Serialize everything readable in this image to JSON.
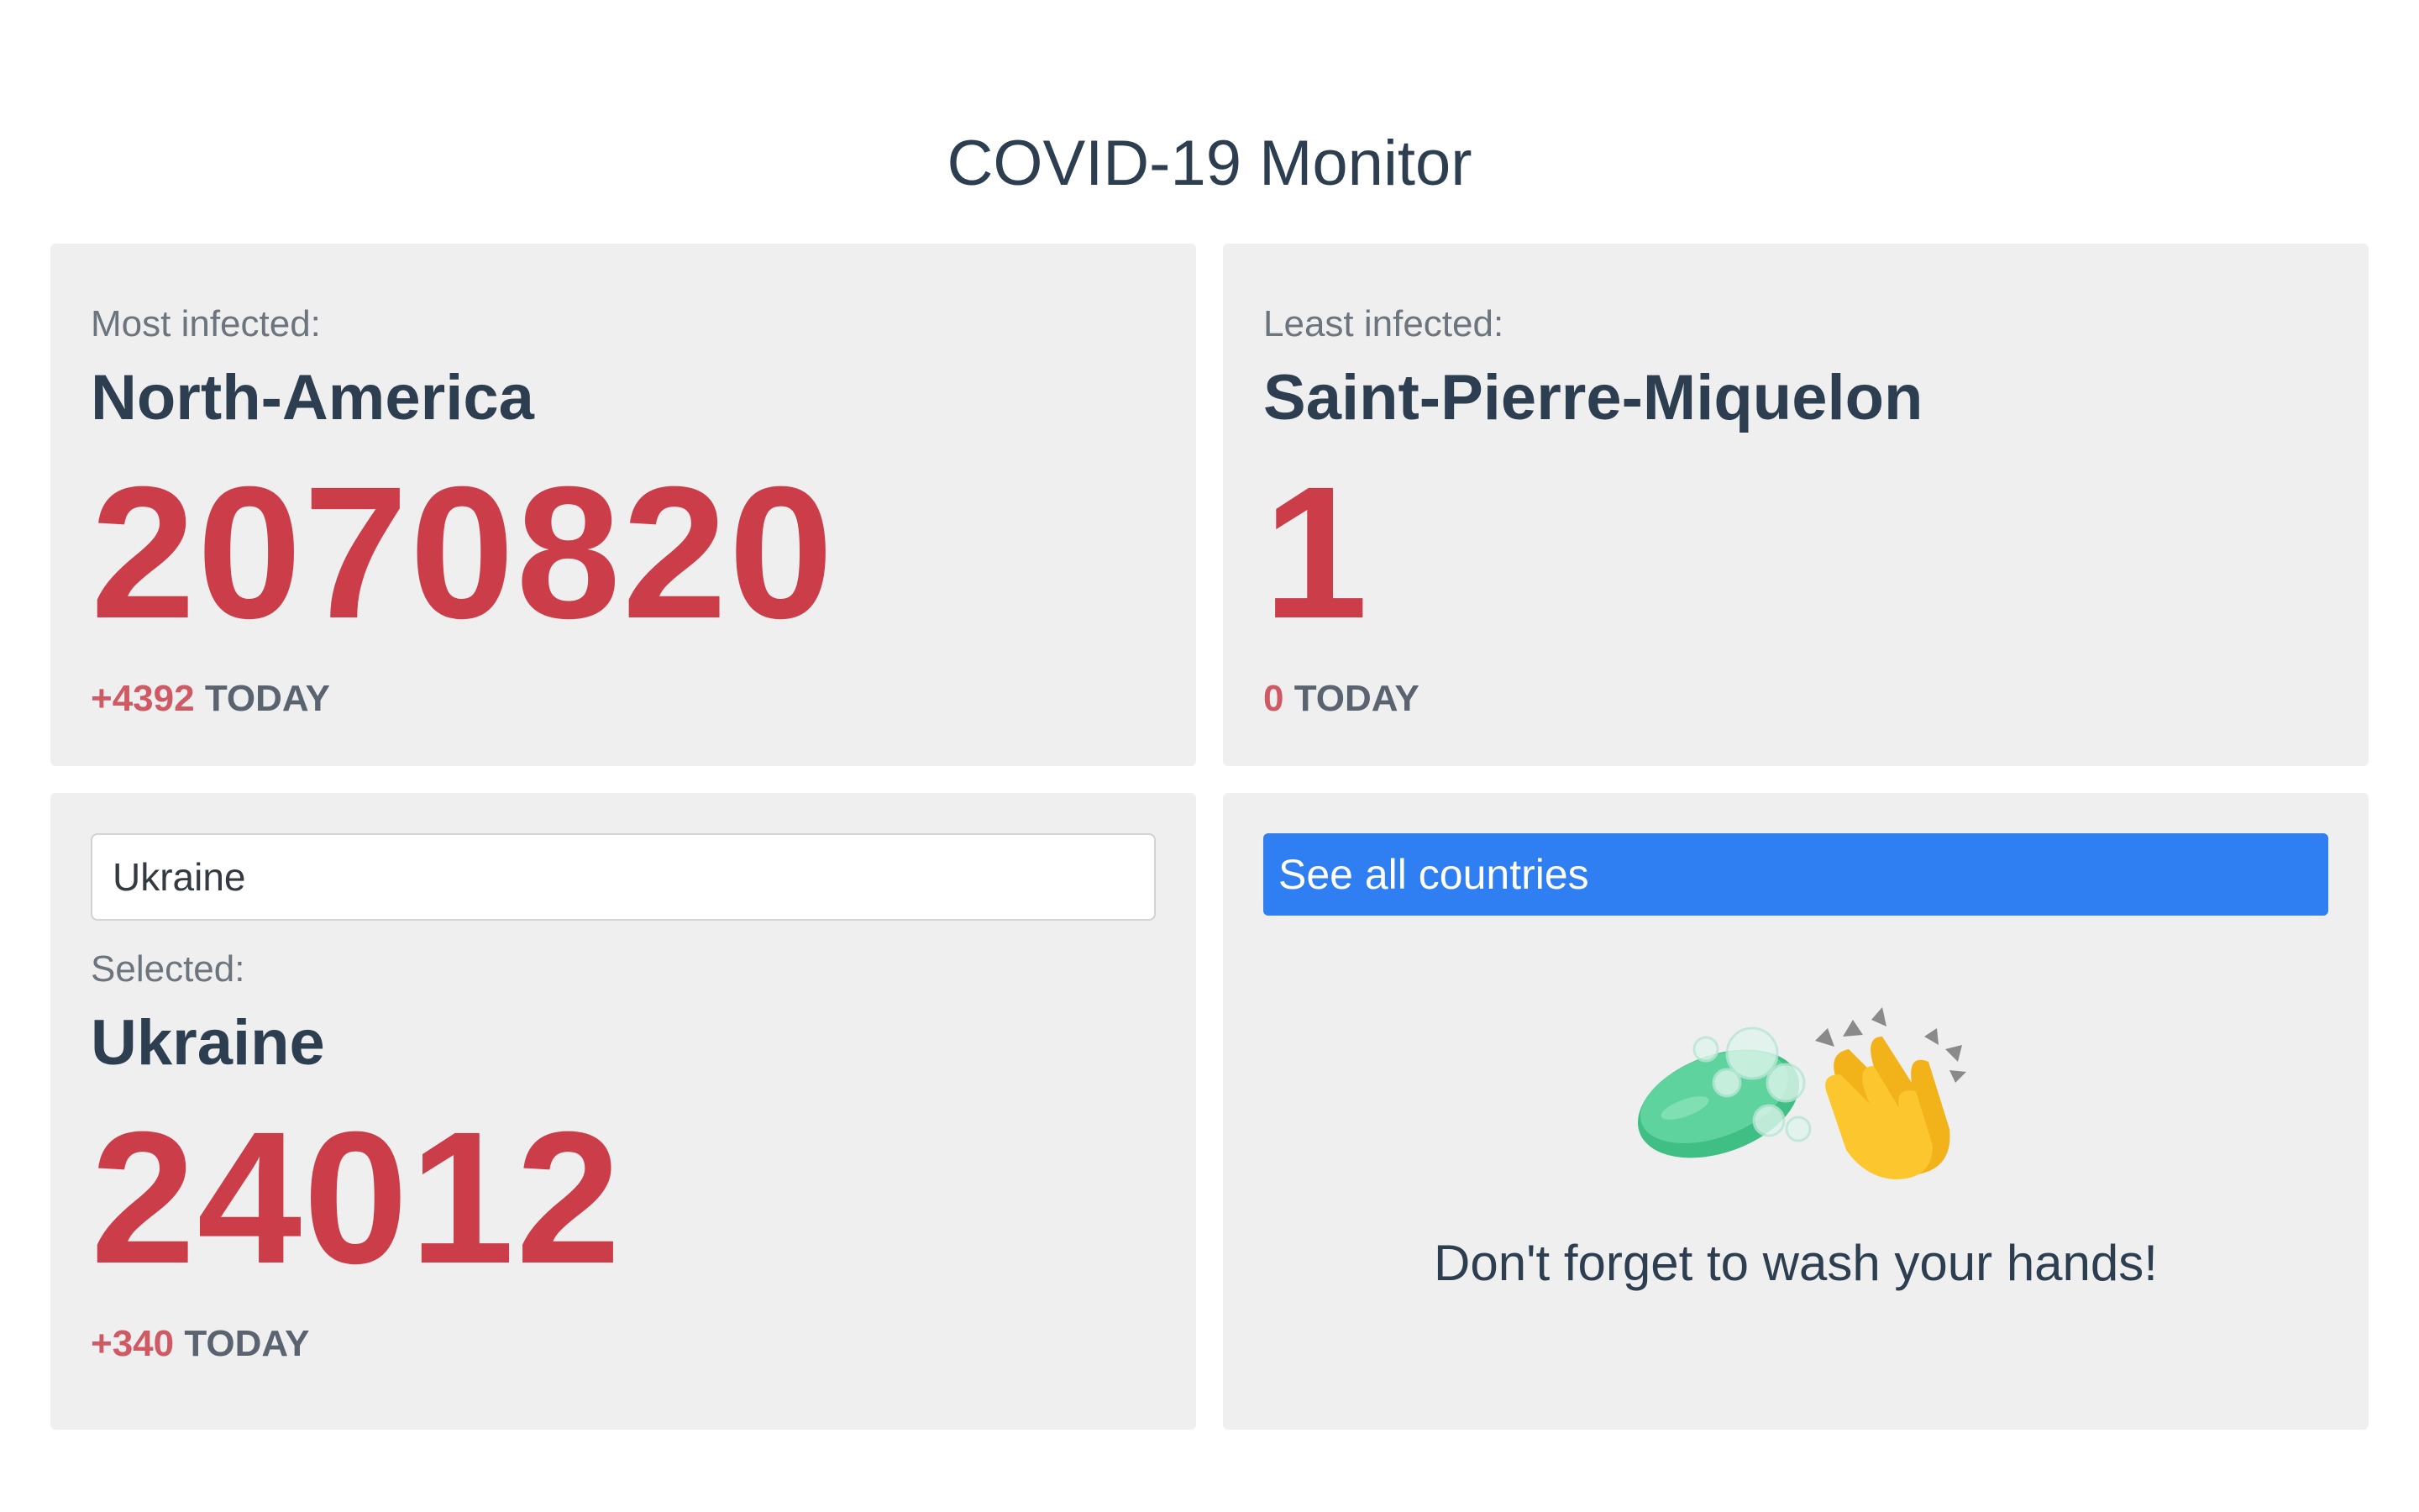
{
  "page": {
    "title": "COVID-19 Monitor"
  },
  "most_infected": {
    "label": "Most infected:",
    "name": "North-America",
    "count": "2070820",
    "delta": "+4392",
    "today_label": "TODAY"
  },
  "least_infected": {
    "label": "Least infected:",
    "name": "Saint-Pierre-Miquelon",
    "count": "1",
    "delta": "0",
    "today_label": "TODAY"
  },
  "selected": {
    "search_value": "Ukraine",
    "label": "Selected:",
    "name": "Ukraine",
    "count": "24012",
    "delta": "+340",
    "today_label": "TODAY"
  },
  "info": {
    "button_label": "See all countries",
    "message": "Don't forget to wash your hands!",
    "icons": [
      "soap-icon",
      "clapping-hands-icon"
    ]
  },
  "colors": {
    "accent_red": "#cc3d4a",
    "button_blue": "#2f7ef2",
    "card_bg": "#efefef",
    "text_dark": "#2c3e50"
  }
}
